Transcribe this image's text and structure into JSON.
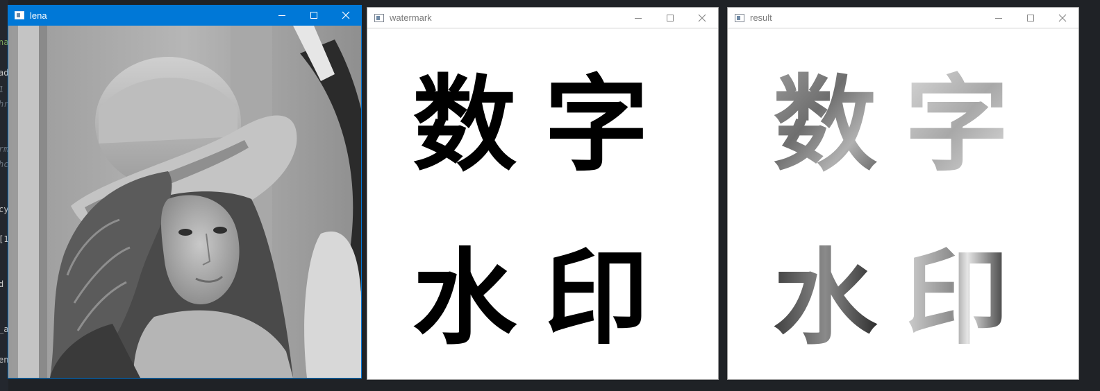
{
  "editor_fragments": [
    "na",
    "ad",
    "1",
    "hr",
    "rm",
    "hc",
    "cy",
    "[1",
    "d",
    "_a",
    "en"
  ],
  "windows": {
    "lena": {
      "title": "lena",
      "active": true,
      "content": "grayscale portrait photo"
    },
    "watermark": {
      "title": "watermark",
      "active": false,
      "chars": [
        "数",
        "字",
        "水",
        "印"
      ]
    },
    "result": {
      "title": "result",
      "active": false,
      "chars": [
        "数",
        "字",
        "水",
        "印"
      ]
    }
  },
  "controls": {
    "minimize_icon": "minimize-icon",
    "maximize_icon": "maximize-icon",
    "close_icon": "close-icon"
  },
  "colors": {
    "active_titlebar": "#0078d7",
    "desktop": "#1f2226",
    "watermark_text": "#000000"
  }
}
